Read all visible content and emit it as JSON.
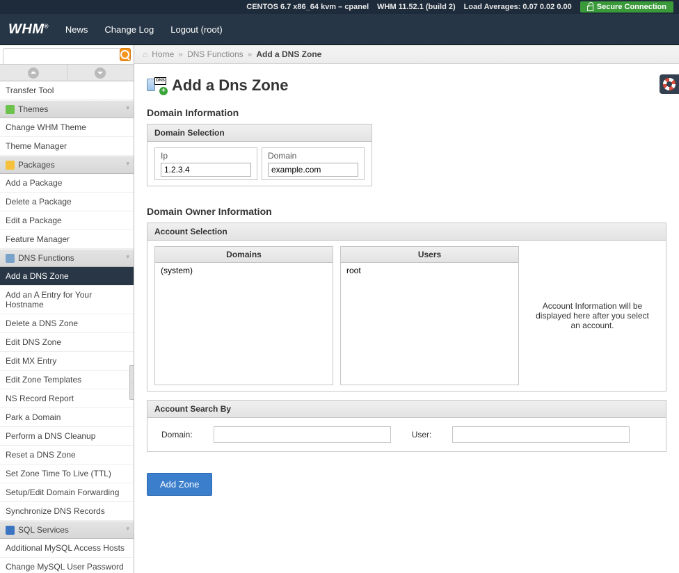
{
  "topbar": {
    "os": "CENTOS 6.7 x86_64 kvm – cpanel",
    "whm": "WHM 11.52.1 (build 2)",
    "load": "Load Averages: 0.07 0.02 0.00",
    "secure": "Secure Connection"
  },
  "nav": {
    "logo": "WHM",
    "news": "News",
    "changelog": "Change Log",
    "logout": "Logout (root)"
  },
  "search": {
    "placeholder": ""
  },
  "breadcrumb": {
    "home": "Home",
    "functions": "DNS Functions",
    "page": "Add a DNS Zone"
  },
  "page": {
    "title": "Add a Dns Zone"
  },
  "sidebar": {
    "transfer_tool": "Transfer Tool",
    "themes_header": "Themes",
    "change_whm_theme": "Change WHM Theme",
    "theme_manager": "Theme Manager",
    "packages_header": "Packages",
    "add_package": "Add a Package",
    "delete_package": "Delete a Package",
    "edit_package": "Edit a Package",
    "feature_manager": "Feature Manager",
    "dns_header": "DNS Functions",
    "add_dns_zone": "Add a DNS Zone",
    "add_a_entry": "Add an A Entry for Your Hostname",
    "delete_dns_zone": "Delete a DNS Zone",
    "edit_dns_zone": "Edit DNS Zone",
    "edit_mx": "Edit MX Entry",
    "edit_zone_templates": "Edit Zone Templates",
    "ns_record": "NS Record Report",
    "park_domain": "Park a Domain",
    "dns_cleanup": "Perform a DNS Cleanup",
    "reset_dns": "Reset a DNS Zone",
    "set_ttl": "Set Zone Time To Live (TTL)",
    "domain_forwarding": "Setup/Edit Domain Forwarding",
    "sync_dns": "Synchronize DNS Records",
    "sql_header": "SQL Services",
    "mysql_hosts": "Additional MySQL Access Hosts",
    "mysql_password": "Change MySQL User Password"
  },
  "domain_info": {
    "section": "Domain Information",
    "panel_header": "Domain Selection",
    "ip_label": "Ip",
    "ip_value": "1.2.3.4",
    "domain_label": "Domain",
    "domain_value": "example.com"
  },
  "owner": {
    "section": "Domain Owner Information",
    "panel_header": "Account Selection",
    "domains_header": "Domains",
    "users_header": "Users",
    "domains_option": "(system)",
    "users_option": "root",
    "info_text": "Account Information will be displayed here after you select an account."
  },
  "search_panel": {
    "header": "Account Search By",
    "domain_label": "Domain:",
    "user_label": "User:"
  },
  "buttons": {
    "add_zone": "Add Zone"
  }
}
